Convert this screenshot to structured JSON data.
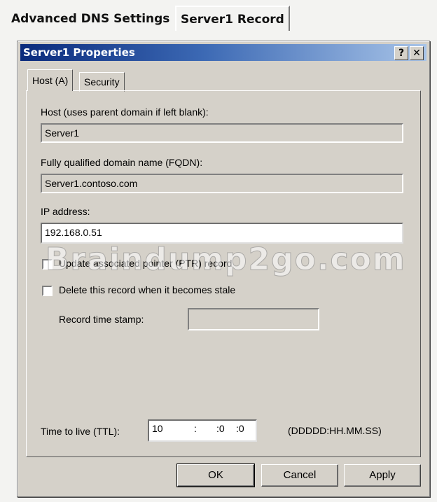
{
  "outer_tabs": {
    "dns_settings": "Advanced DNS Settings",
    "server_record": "Server1 Record"
  },
  "dialog": {
    "title": "Server1 Properties",
    "help_button": "?",
    "close_button": "✕",
    "tabs": [
      "Host (A)",
      "Security"
    ],
    "host_label": "Host (uses parent domain if left blank):",
    "host_value": "Server1",
    "fqdn_label": "Fully qualified domain name (FQDN):",
    "fqdn_value": "Server1.contoso.com",
    "ip_label": "IP address:",
    "ip_value": "192.168.0.51",
    "update_ptr_label": "Update associated pointer (PTR) record",
    "delete_stale_label": "Delete this record when it becomes stale",
    "timestamp_label": "Record time stamp:",
    "timestamp_value": "",
    "ttl_label": "Time to live (TTL):",
    "ttl_days": "10",
    "ttl_hours": ":",
    "ttl_minutes": ":0",
    "ttl_seconds": ":0",
    "ttl_format": "(DDDDD:HH.MM.SS)",
    "ok": "OK",
    "cancel": "Cancel",
    "apply": "Apply"
  },
  "watermark": "Braindump2go.com"
}
